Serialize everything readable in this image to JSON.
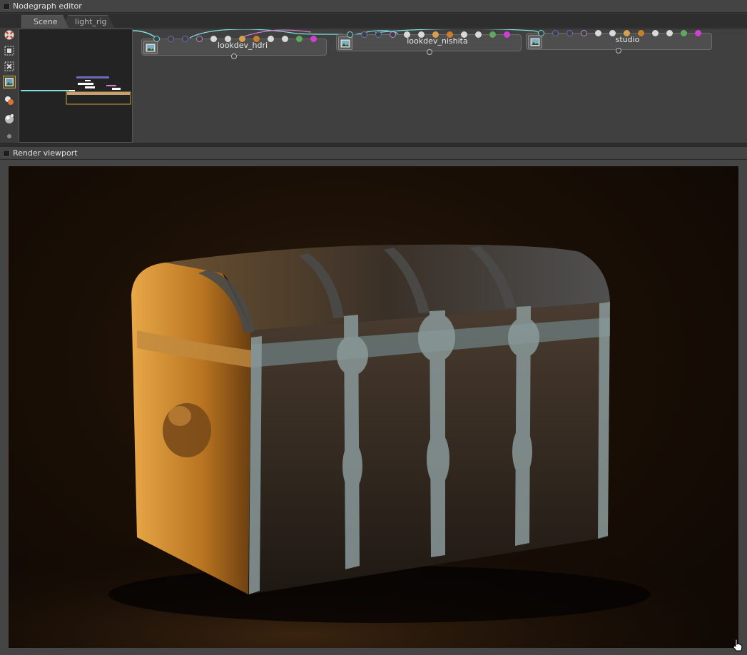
{
  "panels": {
    "nodegraph_title": "Nodegraph editor",
    "viewport_title": "Render viewport"
  },
  "tabs": [
    {
      "label": "Scene"
    },
    {
      "label": "light_rig"
    }
  ],
  "toolbar": {
    "tools": [
      "node-snap-icon",
      "frame-all-icon",
      "frame-selected-icon",
      "render-view-icon",
      "material-icon",
      "shader-ball-icon",
      "small-dot-icon"
    ]
  },
  "nodes": [
    {
      "label": "lookdev_hdri"
    },
    {
      "label": "lookdev_nishita"
    },
    {
      "label": "studio"
    }
  ],
  "colors": {
    "port_blue": "#6b6bb8",
    "port_pink": "#b88ac8",
    "port_white": "#d9d9d9",
    "port_orange": "#d4a050",
    "port_dark_orange": "#c87f2a",
    "port_green": "#5ea95e",
    "port_magenta": "#d040d0",
    "port_cyan": "#6ad8d8",
    "wire_cyan": "#7fe0e0",
    "wire_pink": "#d77ec8"
  }
}
